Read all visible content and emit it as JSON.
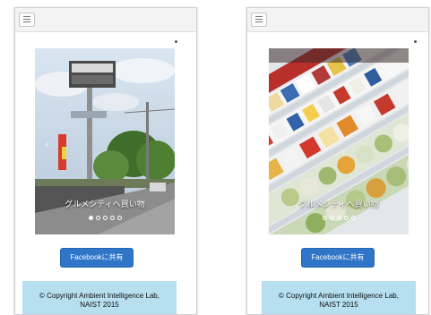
{
  "screens": [
    {
      "slide_caption": "グルメシティへ買い物",
      "share_button": "Facebookに共有",
      "footer": {
        "line1": "© Copyright Ambient Intelligence Lab,",
        "line2": "NAIST 2015"
      },
      "prev_arrow": "‹",
      "active_slide": 1,
      "slide_count": 5
    },
    {
      "slide_caption": "グルメシティへ買い物",
      "share_button": "Facebookに共有",
      "footer": {
        "line1": "© Copyright Ambient Intelligence Lab,",
        "line2": "NAIST 2015"
      },
      "slide_count": 5
    }
  ],
  "icons": [
    "menu-icon",
    "chevron-left-icon"
  ]
}
